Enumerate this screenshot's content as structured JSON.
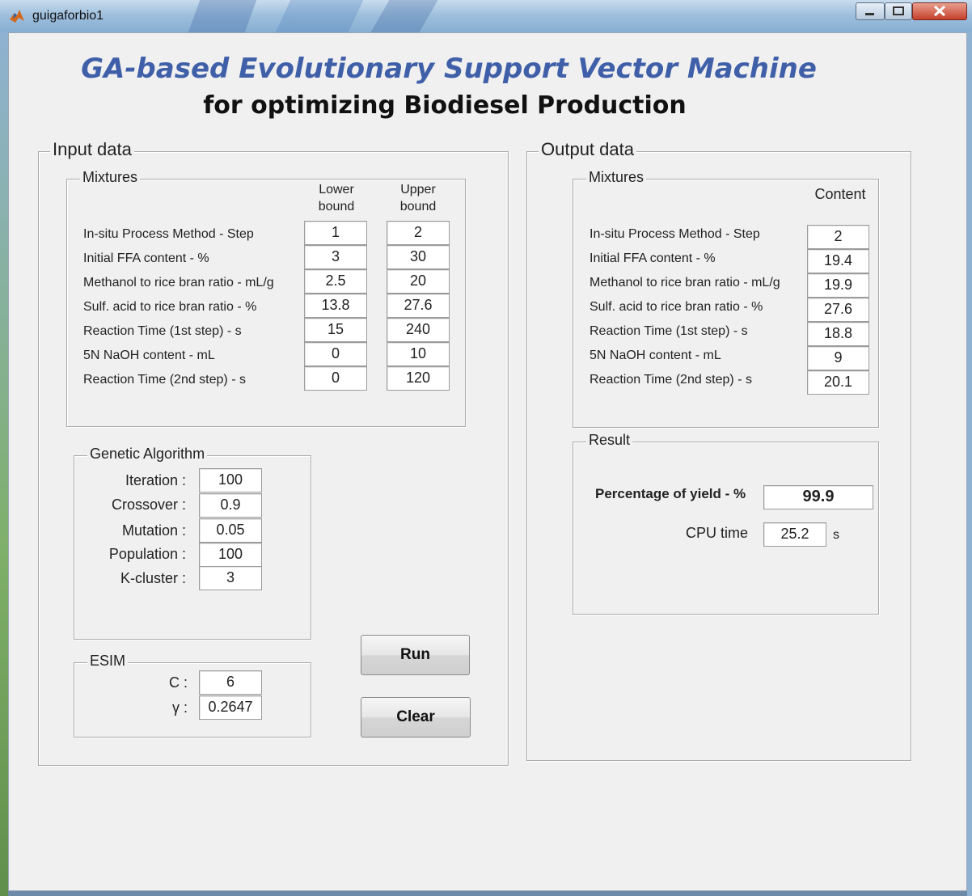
{
  "window": {
    "title": "guigaforbio1"
  },
  "heading": {
    "line1": "GA-based Evolutionary Support Vector Machine",
    "line2": "for optimizing Biodiesel Production"
  },
  "input": {
    "title": "Input data",
    "mixtures": {
      "title": "Mixtures",
      "lower_header": "Lower\nbound",
      "upper_header": "Upper\nbound",
      "rows": [
        {
          "label": "In-situ Process Method - Step",
          "lower": "1",
          "upper": "2"
        },
        {
          "label": "Initial FFA content - %",
          "lower": "3",
          "upper": "30"
        },
        {
          "label": "Methanol to rice bran ratio - mL/g",
          "lower": "2.5",
          "upper": "20"
        },
        {
          "label": "Sulf. acid to rice bran ratio - %",
          "lower": "13.8",
          "upper": "27.6"
        },
        {
          "label": "Reaction Time (1st step) - s",
          "lower": "15",
          "upper": "240"
        },
        {
          "label": "5N NaOH content - mL",
          "lower": "0",
          "upper": "10"
        },
        {
          "label": "Reaction Time (2nd step) - s",
          "lower": "0",
          "upper": "120"
        }
      ]
    },
    "ga": {
      "title": "Genetic Algorithm",
      "rows": [
        {
          "label": "Iteration :",
          "value": "100"
        },
        {
          "label": "Crossover :",
          "value": "0.9"
        },
        {
          "label": "Mutation :",
          "value": "0.05"
        },
        {
          "label": "Population :",
          "value": "100"
        },
        {
          "label": "K-cluster :",
          "value": "3"
        }
      ]
    },
    "esim": {
      "title": "ESIM",
      "rows": [
        {
          "label": "C :",
          "value": "6"
        },
        {
          "label": "γ :",
          "value": "0.2647"
        }
      ]
    }
  },
  "buttons": {
    "run": "Run",
    "clear": "Clear"
  },
  "output": {
    "title": "Output data",
    "mixtures": {
      "title": "Mixtures",
      "content_header": "Content",
      "rows": [
        {
          "label": "In-situ Process Method - Step",
          "value": "2"
        },
        {
          "label": "Initial FFA content - %",
          "value": "19.4"
        },
        {
          "label": "Methanol to rice bran ratio - mL/g",
          "value": "19.9"
        },
        {
          "label": "Sulf. acid to rice bran ratio - %",
          "value": "27.6"
        },
        {
          "label": "Reaction Time (1st step) - s",
          "value": "18.8"
        },
        {
          "label": "5N NaOH content - mL",
          "value": "9"
        },
        {
          "label": "Reaction Time (2nd step) - s",
          "value": "20.1"
        }
      ]
    },
    "result": {
      "title": "Result",
      "yield_label": "Percentage of yield - %",
      "yield_value": "99.9",
      "cpu_label": "CPU time",
      "cpu_value": "25.2",
      "cpu_unit": "s"
    }
  }
}
